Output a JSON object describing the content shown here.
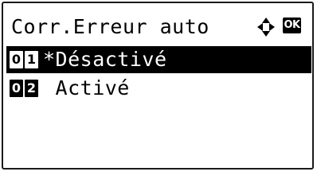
{
  "screen": {
    "title": "Corr.Erreur auto",
    "nav_icon": "four-way-arrow-icon",
    "ok_label": "OK"
  },
  "options": [
    {
      "digits": [
        "0",
        "1"
      ],
      "label": "*Désactivé",
      "selected": true
    },
    {
      "digits": [
        "0",
        "2"
      ],
      "label": " Activé",
      "selected": false
    }
  ],
  "colors": {
    "foreground": "#000000",
    "background": "#ffffff",
    "highlight": "#000000"
  }
}
